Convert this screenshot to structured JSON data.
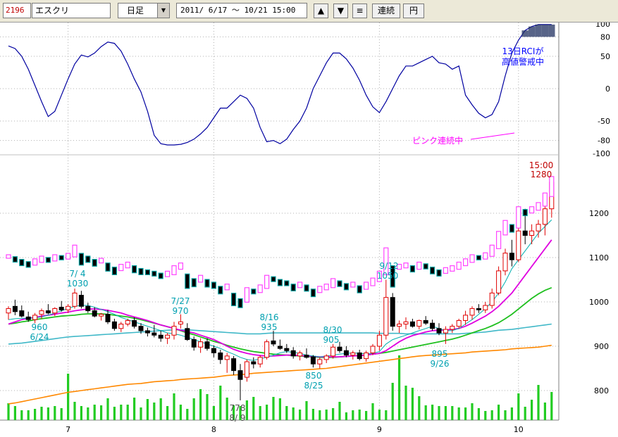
{
  "toolbar": {
    "code": "2196",
    "name": "エスクリ",
    "period": "日足",
    "range": "2011/ 6/17 ～ 10/21 15:00",
    "up_label": "▲",
    "down_label": "▼",
    "menu_label": "≡",
    "continuous_label": "連続",
    "yen_label": "円"
  },
  "annotations": {
    "rci_title_1": "13日RCIが",
    "rci_title_2": "高値警戒中",
    "pink_label": "ピンク連続中",
    "last_time": "15:00",
    "last_price": "1280",
    "hi1_date": "7/ 4",
    "hi1_price": "1030",
    "lo1_price": "960",
    "lo1_date": "6/24",
    "hi2_date": "7/27",
    "hi2_price": "970",
    "hi3_date": "8/16",
    "hi3_price": "935",
    "lo2_price": "778",
    "lo2_date": "8/ 9",
    "hi4_date": "8/30",
    "hi4_price": "905",
    "lo3_price": "850",
    "lo3_date": "8/25",
    "hi5_date": "9/12",
    "hi5_price": "1050",
    "lo4_price": "895",
    "lo4_date": "9/26"
  },
  "colors": {
    "rci": "#0000a0",
    "up_candle": "#e00000",
    "down_candle": "#000000",
    "ma_short": "#00b0b0",
    "ma_mid": "#e000e0",
    "ma_long": "#20c020",
    "ma_xlong": "#40b8c8",
    "ma_200": "#ff8800",
    "volume": "#22cc22",
    "pink_box": "#ff44ff",
    "teal_box": "#00a0a0",
    "annotation": "#00a0b0",
    "rci_title": "#0000ff",
    "pink_label": "#ff00ff",
    "price_label": "#c00000"
  },
  "chart_data": {
    "type": "candlestick",
    "rci_axis": {
      "ticks": [
        "100",
        "80",
        "50",
        "0",
        "-50",
        "-80",
        "-100"
      ],
      "range": [
        -100,
        100
      ]
    },
    "price_axis": {
      "ticks": [
        "1200",
        "1100",
        "1000",
        "900",
        "800"
      ],
      "range": [
        735,
        1310
      ]
    },
    "x_labels": [
      {
        "label": "7",
        "index": 9
      },
      {
        "label": "8",
        "index": 31
      },
      {
        "label": "9",
        "index": 56
      },
      {
        "label": "10",
        "index": 77
      }
    ],
    "rci": [
      66,
      62,
      50,
      30,
      5,
      -20,
      -43,
      -35,
      -10,
      15,
      38,
      52,
      49,
      55,
      65,
      72,
      70,
      58,
      38,
      15,
      -5,
      -35,
      -72,
      -85,
      -87,
      -87,
      -86,
      -83,
      -78,
      -70,
      -60,
      -45,
      -30,
      -30,
      -20,
      -10,
      -15,
      -30,
      -60,
      -82,
      -80,
      -85,
      -78,
      -63,
      -50,
      -30,
      0,
      20,
      40,
      55,
      55,
      46,
      32,
      13,
      -10,
      -28,
      -37,
      -20,
      0,
      20,
      35,
      35,
      40,
      45,
      50,
      40,
      38,
      30,
      35,
      -10,
      -25,
      -38,
      -45,
      -40,
      -20,
      20,
      55,
      75,
      90,
      96,
      99,
      99,
      99,
      99,
      98,
      97,
      96,
      96,
      95,
      95
    ],
    "ohlc": [
      [
        975,
        990,
        960,
        985
      ],
      [
        990,
        1005,
        970,
        978
      ],
      [
        980,
        992,
        965,
        968
      ],
      [
        966,
        978,
        955,
        960
      ],
      [
        960,
        975,
        952,
        970
      ],
      [
        972,
        985,
        962,
        980
      ],
      [
        980,
        995,
        972,
        975
      ],
      [
        975,
        988,
        968,
        985
      ],
      [
        988,
        1002,
        978,
        982
      ],
      [
        982,
        995,
        975,
        990
      ],
      [
        990,
        1030,
        985,
        1020
      ],
      [
        1015,
        1025,
        985,
        990
      ],
      [
        990,
        998,
        975,
        980
      ],
      [
        980,
        988,
        965,
        968
      ],
      [
        968,
        975,
        958,
        972
      ],
      [
        972,
        982,
        950,
        955
      ],
      [
        955,
        962,
        935,
        940
      ],
      [
        940,
        955,
        932,
        950
      ],
      [
        950,
        962,
        945,
        958
      ],
      [
        958,
        965,
        940,
        945
      ],
      [
        945,
        952,
        928,
        935
      ],
      [
        935,
        942,
        922,
        930
      ],
      [
        930,
        948,
        920,
        925
      ],
      [
        925,
        935,
        910,
        918
      ],
      [
        918,
        930,
        905,
        925
      ],
      [
        925,
        955,
        915,
        945
      ],
      [
        950,
        972,
        940,
        955
      ],
      [
        940,
        952,
        912,
        915
      ],
      [
        915,
        922,
        890,
        898
      ],
      [
        898,
        918,
        885,
        910
      ],
      [
        910,
        918,
        890,
        895
      ],
      [
        895,
        902,
        875,
        885
      ],
      [
        885,
        892,
        860,
        870
      ],
      [
        870,
        885,
        840,
        878
      ],
      [
        872,
        878,
        835,
        845
      ],
      [
        845,
        860,
        778,
        825
      ],
      [
        830,
        870,
        820,
        865
      ],
      [
        865,
        875,
        850,
        860
      ],
      [
        860,
        880,
        852,
        875
      ],
      [
        875,
        915,
        870,
        910
      ],
      [
        912,
        935,
        900,
        905
      ],
      [
        900,
        915,
        892,
        895
      ],
      [
        895,
        905,
        885,
        890
      ],
      [
        890,
        898,
        872,
        878
      ],
      [
        878,
        890,
        868,
        885
      ],
      [
        880,
        895,
        872,
        875
      ],
      [
        876,
        880,
        852,
        860
      ],
      [
        860,
        875,
        850,
        870
      ],
      [
        870,
        882,
        862,
        878
      ],
      [
        878,
        905,
        872,
        898
      ],
      [
        898,
        910,
        885,
        890
      ],
      [
        890,
        900,
        875,
        880
      ],
      [
        880,
        890,
        870,
        885
      ],
      [
        885,
        892,
        868,
        872
      ],
      [
        872,
        890,
        865,
        885
      ],
      [
        885,
        905,
        880,
        900
      ],
      [
        900,
        935,
        890,
        925
      ],
      [
        925,
        1050,
        915,
        1010
      ],
      [
        1010,
        1020,
        935,
        945
      ],
      [
        945,
        958,
        930,
        950
      ],
      [
        950,
        965,
        938,
        955
      ],
      [
        955,
        962,
        942,
        945
      ],
      [
        945,
        960,
        938,
        958
      ],
      [
        958,
        968,
        948,
        952
      ],
      [
        952,
        960,
        935,
        940
      ],
      [
        940,
        952,
        925,
        930
      ],
      [
        930,
        945,
        905,
        938
      ],
      [
        938,
        950,
        930,
        945
      ],
      [
        945,
        962,
        940,
        958
      ],
      [
        958,
        980,
        948,
        970
      ],
      [
        970,
        990,
        960,
        985
      ],
      [
        985,
        995,
        975,
        982
      ],
      [
        982,
        1000,
        975,
        992
      ],
      [
        992,
        1030,
        985,
        1020
      ],
      [
        1020,
        1080,
        1015,
        1070
      ],
      [
        1070,
        1120,
        1060,
        1110
      ],
      [
        1110,
        1140,
        1080,
        1095
      ],
      [
        1095,
        1170,
        1090,
        1160
      ],
      [
        1160,
        1210,
        1130,
        1150
      ],
      [
        1150,
        1175,
        1130,
        1160
      ],
      [
        1160,
        1185,
        1145,
        1175
      ],
      [
        1175,
        1220,
        1150,
        1210
      ],
      [
        1210,
        1280,
        1190,
        1270
      ]
    ],
    "ma_short": [
      960,
      962,
      963,
      963,
      964,
      966,
      970,
      975,
      980,
      985,
      990,
      992,
      992,
      988,
      983,
      978,
      972,
      965,
      960,
      955,
      950,
      945,
      940,
      935,
      930,
      928,
      925,
      920,
      915,
      910,
      905,
      900,
      895,
      888,
      882,
      875,
      870,
      868,
      872,
      875,
      880,
      885,
      888,
      886,
      884,
      880,
      878,
      876,
      878,
      880,
      882,
      884,
      885,
      884,
      883,
      884,
      888,
      905,
      915,
      920,
      925,
      930,
      935,
      940,
      945,
      940,
      935,
      935,
      940,
      950,
      960,
      972,
      985,
      1000,
      1020,
      1045,
      1075,
      1095,
      1115,
      1135,
      1155,
      1170,
      1185
    ],
    "ma_mid": [
      950,
      955,
      960,
      963,
      965,
      968,
      970,
      972,
      975,
      977,
      980,
      982,
      984,
      984,
      983,
      981,
      978,
      975,
      970,
      966,
      962,
      958,
      953,
      948,
      944,
      940,
      936,
      933,
      930,
      925,
      920,
      915,
      908,
      900,
      893,
      888,
      884,
      881,
      879,
      878,
      878,
      879,
      880,
      880,
      879,
      878,
      877,
      876,
      876,
      876,
      876,
      877,
      878,
      879,
      880,
      882,
      884,
      890,
      900,
      910,
      918,
      924,
      928,
      932,
      935,
      936,
      937,
      938,
      940,
      945,
      952,
      960,
      968,
      978,
      990,
      1005,
      1020,
      1040,
      1060,
      1080,
      1100,
      1120,
      1140
    ],
    "ma_long": [
      950,
      952,
      955,
      957,
      960,
      962,
      964,
      966,
      968,
      969,
      970,
      972,
      973,
      973,
      973,
      972,
      970,
      968,
      966,
      963,
      960,
      956,
      952,
      948,
      944,
      940,
      935,
      930,
      926,
      921,
      916,
      911,
      907,
      902,
      898,
      894,
      891,
      888,
      886,
      884,
      882,
      881,
      880,
      879,
      878,
      877,
      876,
      875,
      875,
      875,
      876,
      877,
      878,
      879,
      880,
      882,
      884,
      886,
      889,
      892,
      895,
      898,
      901,
      904,
      907,
      910,
      913,
      916,
      920,
      925,
      930,
      935,
      940,
      946,
      953,
      962,
      972,
      984,
      996,
      1008,
      1018,
      1026,
      1032
    ],
    "ma_xlong": [
      905,
      906,
      907,
      909,
      911,
      913,
      915,
      917,
      919,
      921,
      922,
      923,
      924,
      925,
      926,
      927,
      928,
      929,
      930,
      931,
      932,
      933,
      934,
      935,
      936,
      937,
      937,
      937,
      936,
      935,
      934,
      933,
      932,
      931,
      930,
      929,
      928,
      928,
      928,
      929,
      930,
      930,
      930,
      930,
      930,
      930,
      930,
      930,
      930,
      930,
      930,
      930,
      930,
      930,
      930,
      930,
      929,
      929,
      929,
      929,
      928,
      928,
      928,
      928,
      928,
      928,
      928,
      928,
      928,
      929,
      930,
      931,
      932,
      934,
      936,
      937,
      938,
      940,
      942,
      944,
      946,
      948,
      950
    ],
    "ma_200": [
      770,
      772,
      775,
      778,
      781,
      784,
      787,
      790,
      793,
      796,
      798,
      800,
      802,
      804,
      806,
      808,
      810,
      812,
      814,
      815,
      816,
      818,
      820,
      821,
      822,
      823,
      825,
      826,
      827,
      828,
      829,
      830,
      832,
      834,
      835,
      836,
      837,
      839,
      840,
      841,
      842,
      843,
      844,
      845,
      846,
      847,
      848,
      849,
      850,
      852,
      854,
      856,
      858,
      860,
      862,
      864,
      866,
      868,
      870,
      872,
      874,
      876,
      878,
      879,
      880,
      881,
      882,
      883,
      884,
      885,
      887,
      888,
      889,
      890,
      891,
      892,
      894,
      895,
      896,
      897,
      898,
      900,
      902
    ],
    "volume": [
      24,
      20,
      14,
      14,
      16,
      19,
      18,
      20,
      17,
      66,
      26,
      20,
      18,
      22,
      21,
      31,
      19,
      22,
      22,
      32,
      18,
      30,
      25,
      31,
      20,
      38,
      22,
      16,
      31,
      44,
      37,
      20,
      49,
      32,
      21,
      20,
      28,
      33,
      20,
      22,
      33,
      31,
      20,
      18,
      15,
      27,
      16,
      14,
      15,
      17,
      26,
      11,
      14,
      15,
      13,
      24,
      15,
      14,
      53,
      92,
      49,
      46,
      34,
      21,
      22,
      20,
      20,
      20,
      18,
      18,
      24,
      17,
      13,
      14,
      22,
      14,
      18,
      38,
      19,
      29,
      50,
      25,
      40
    ]
  }
}
